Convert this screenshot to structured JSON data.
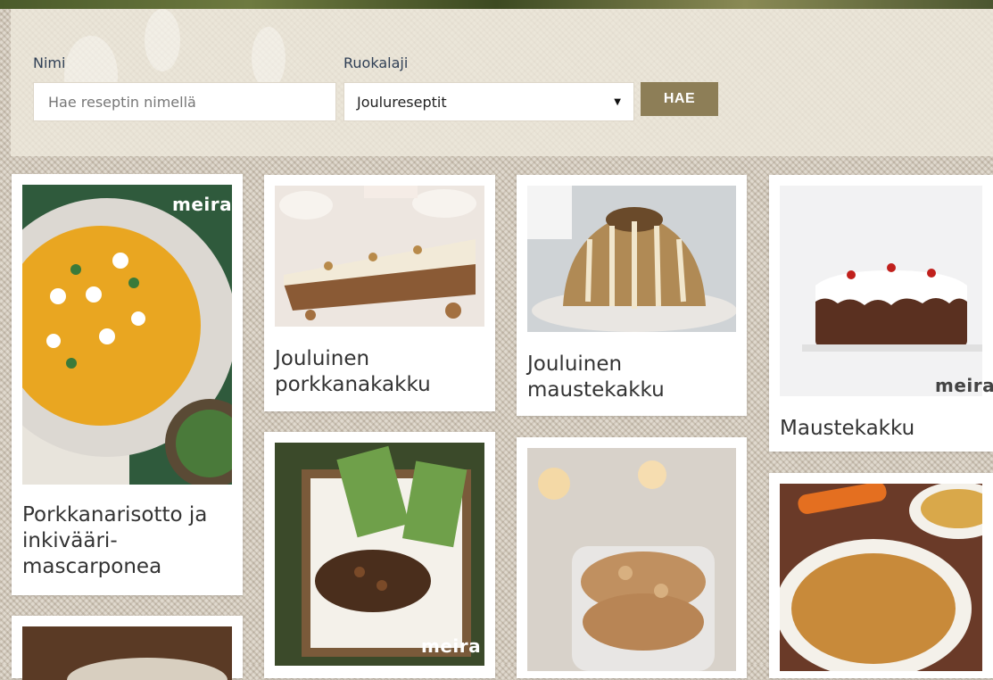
{
  "search": {
    "name_label": "Nimi",
    "name_placeholder": "Hae reseptin nimellä",
    "category_label": "Ruokalaji",
    "category_selected": "Joulureseptit",
    "submit_label": "HAE"
  },
  "brand_logo": "meira",
  "cards": [
    {
      "title": "Porkkanarisotto ja inkivääri-mascarponea"
    },
    {
      "title": "Jouluinen porkkanakakku"
    },
    {
      "title": "Jouluinen maustekakku"
    },
    {
      "title": "Maustekakku"
    }
  ]
}
